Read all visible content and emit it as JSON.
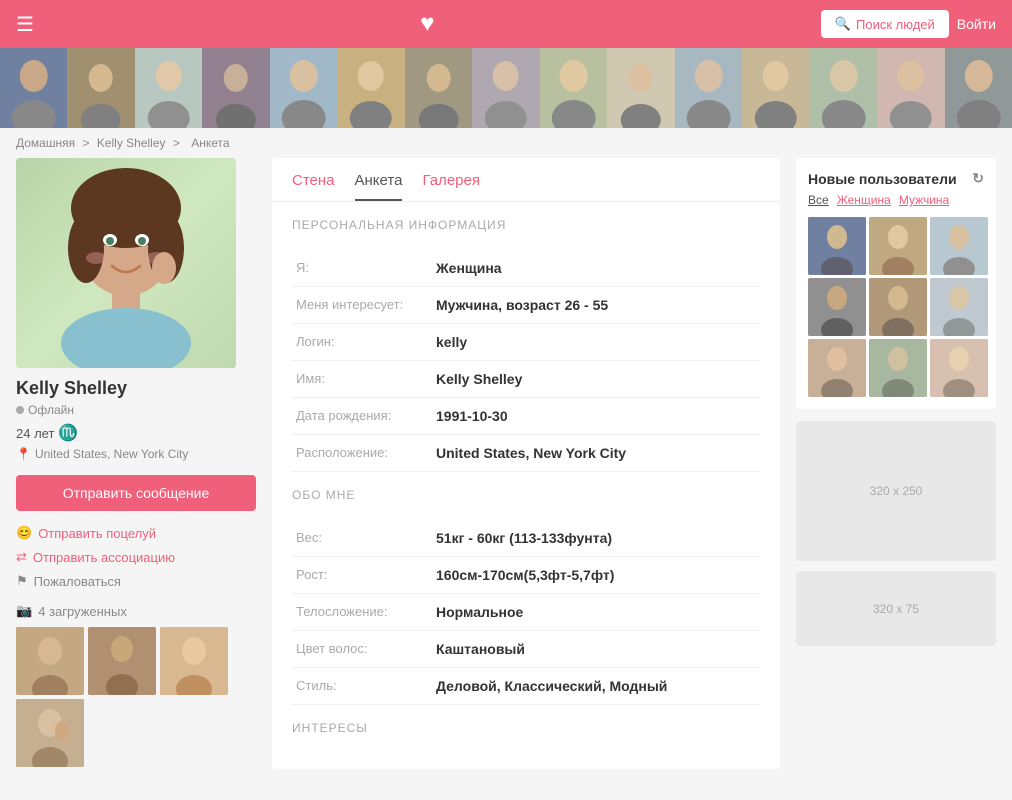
{
  "header": {
    "menu_icon": "☰",
    "heart_icon": "♥",
    "search_button": "Поиск людей",
    "login_button": "Войти"
  },
  "breadcrumb": {
    "home": "Домашняя",
    "separator1": ">",
    "user": "Kelly Shelley",
    "separator2": ">",
    "page": "Анкета"
  },
  "tabs": {
    "wall": "Стена",
    "profile": "Анкета",
    "gallery": "Галерея"
  },
  "profile": {
    "name": "Kelly Shelley",
    "status": "Офлайн",
    "age": "24 лет",
    "zodiac": "♏",
    "location": "United States, New York City",
    "send_message": "Отправить сообщение",
    "actions": {
      "kiss": "Отправить поцелуй",
      "association": "Отправить ассоциацию",
      "report": "Пожаловаться"
    },
    "photos_count": "4 загруженных"
  },
  "personal_info": {
    "section_title": "ПЕРСОНАЛЬНАЯ ИНФОРМАЦИЯ",
    "fields": [
      {
        "label": "Я:",
        "value": "Женщина"
      },
      {
        "label": "Меня интересует:",
        "value": "Мужчина, возраст 26 - 55"
      },
      {
        "label": "Логин:",
        "value": "kelly"
      },
      {
        "label": "Имя:",
        "value": "Kelly Shelley"
      },
      {
        "label": "Дата рождения:",
        "value": "1991-10-30"
      },
      {
        "label": "Расположение:",
        "value": "United States, New York City"
      }
    ]
  },
  "about_me": {
    "section_title": "ОБО МНЕ",
    "fields": [
      {
        "label": "Вес:",
        "value": "51кг - 60кг (113-133фунта)"
      },
      {
        "label": "Рост:",
        "value": "160см-170см(5,3фт-5,7фт)"
      },
      {
        "label": "Телосложение:",
        "value": "Нормальное"
      },
      {
        "label": "Цвет волос:",
        "value": "Каштановый"
      },
      {
        "label": "Стиль:",
        "value": "Деловой, Классический, Модный"
      }
    ]
  },
  "interests": {
    "section_title": "ИНТЕРЕСЫ"
  },
  "right_sidebar": {
    "new_users_title": "Новые пользователи",
    "filter_all": "Все",
    "filter_female": "Женщина",
    "filter_male": "Мужчина",
    "ad_large": "320 x 250",
    "ad_small": "320 x 75"
  }
}
